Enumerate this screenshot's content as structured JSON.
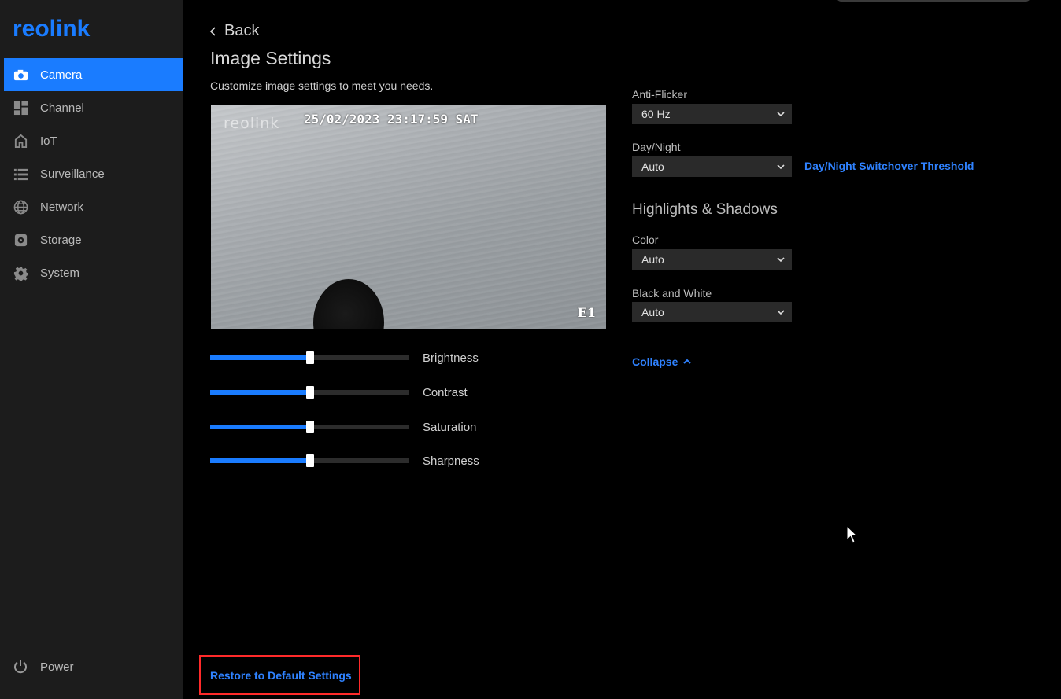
{
  "brand": {
    "logo_text": "reolink",
    "color": "#1a7cff"
  },
  "sidebar": {
    "items": [
      {
        "label": "Camera",
        "icon": "camera-icon",
        "active": true
      },
      {
        "label": "Channel",
        "icon": "grid-icon",
        "active": false
      },
      {
        "label": "IoT",
        "icon": "home-icon",
        "active": false
      },
      {
        "label": "Surveillance",
        "icon": "list-icon",
        "active": false
      },
      {
        "label": "Network",
        "icon": "globe-icon",
        "active": false
      },
      {
        "label": "Storage",
        "icon": "storage-icon",
        "active": false
      },
      {
        "label": "System",
        "icon": "gear-icon",
        "active": false
      }
    ],
    "power_label": "Power"
  },
  "header": {
    "back_label": "Back",
    "title": "Image Settings",
    "subtitle": "Customize image settings to meet you needs."
  },
  "preview": {
    "watermark": "reolink",
    "timestamp": "25/02/2023 23:17:59 SAT",
    "camera_name": "E1"
  },
  "sliders": [
    {
      "label": "Brightness",
      "value": 50
    },
    {
      "label": "Contrast",
      "value": 50
    },
    {
      "label": "Saturation",
      "value": 50
    },
    {
      "label": "Sharpness",
      "value": 50
    }
  ],
  "settings": {
    "anti_flicker": {
      "label": "Anti-Flicker",
      "value": "60 Hz"
    },
    "day_night": {
      "label": "Day/Night",
      "value": "Auto",
      "threshold_link": "Day/Night Switchover Threshold"
    },
    "highlights_title": "Highlights & Shadows",
    "color": {
      "label": "Color",
      "value": "Auto"
    },
    "black_white": {
      "label": "Black and White",
      "value": "Auto"
    },
    "collapse_label": "Collapse"
  },
  "footer": {
    "restore_label": "Restore to Default Settings"
  },
  "colors": {
    "accent": "#1a7cff",
    "link": "#2f82ff",
    "highlight_border": "#ff2a2a"
  }
}
